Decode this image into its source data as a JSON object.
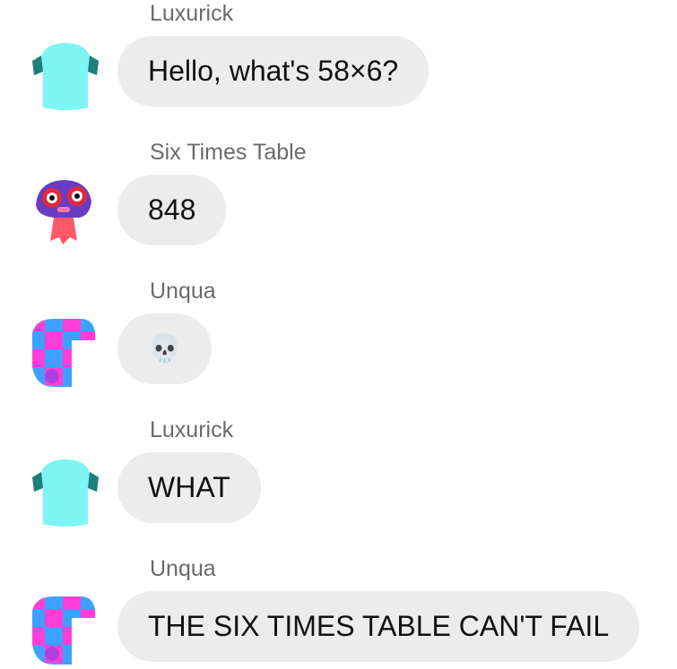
{
  "messages": [
    {
      "sender": "Luxurick",
      "text": "Hello, what's 58×6?",
      "avatar": "cyan-shirt-icon"
    },
    {
      "sender": "Six Times Table",
      "text": "848",
      "avatar": "red-octopus-icon"
    },
    {
      "sender": "Unqua",
      "text": "💀",
      "avatar": "checkered-pink-blue-icon"
    },
    {
      "sender": "Luxurick",
      "text": "WHAT",
      "avatar": "cyan-shirt-icon"
    },
    {
      "sender": "Unqua",
      "text": "THE SIX TIMES TABLE CAN'T FAIL",
      "avatar": "checkered-pink-blue-icon"
    }
  ],
  "colors": {
    "bubble": "#ececec",
    "sender": "#6b6b6b",
    "cyan": "#7ff4f4",
    "pink": "#ff3fd8",
    "blue": "#3fa0ff",
    "purple": "#6a3cc4",
    "red": "#e02a3a"
  }
}
